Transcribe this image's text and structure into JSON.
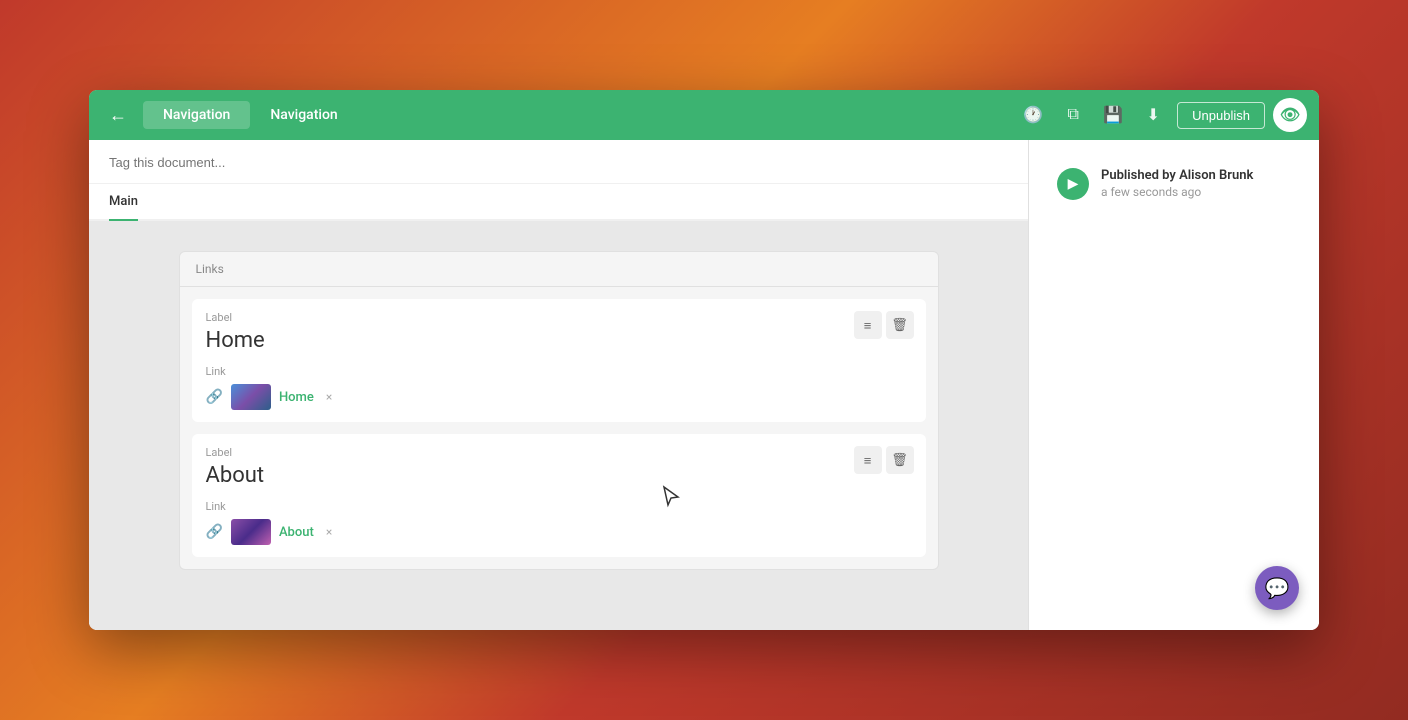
{
  "toolbar": {
    "back_label": "←",
    "tab_label": "Navigation",
    "page_title": "Navigation",
    "unpublish_label": "Unpublish",
    "icons": {
      "history": "🕐",
      "copy": "⧉",
      "save": "💾",
      "download": "⬇"
    }
  },
  "tag_bar": {
    "placeholder": "Tag this document..."
  },
  "tabs": [
    {
      "label": "Main",
      "active": true
    }
  ],
  "links_section": {
    "header": "Links",
    "items": [
      {
        "label_text": "Label",
        "title": "Home",
        "link_label": "Link",
        "link_name": "Home",
        "thumbnail_type": "home"
      },
      {
        "label_text": "Label",
        "title": "About",
        "link_label": "Link",
        "link_name": "About",
        "thumbnail_type": "about"
      }
    ]
  },
  "sidebar": {
    "published_by": "Published by Alison Brunk",
    "published_time": "a few seconds ago"
  },
  "chat": {
    "icon": "💬"
  },
  "actions": {
    "drag_icon": "≡",
    "delete_icon": "🗑",
    "remove_icon": "×"
  }
}
